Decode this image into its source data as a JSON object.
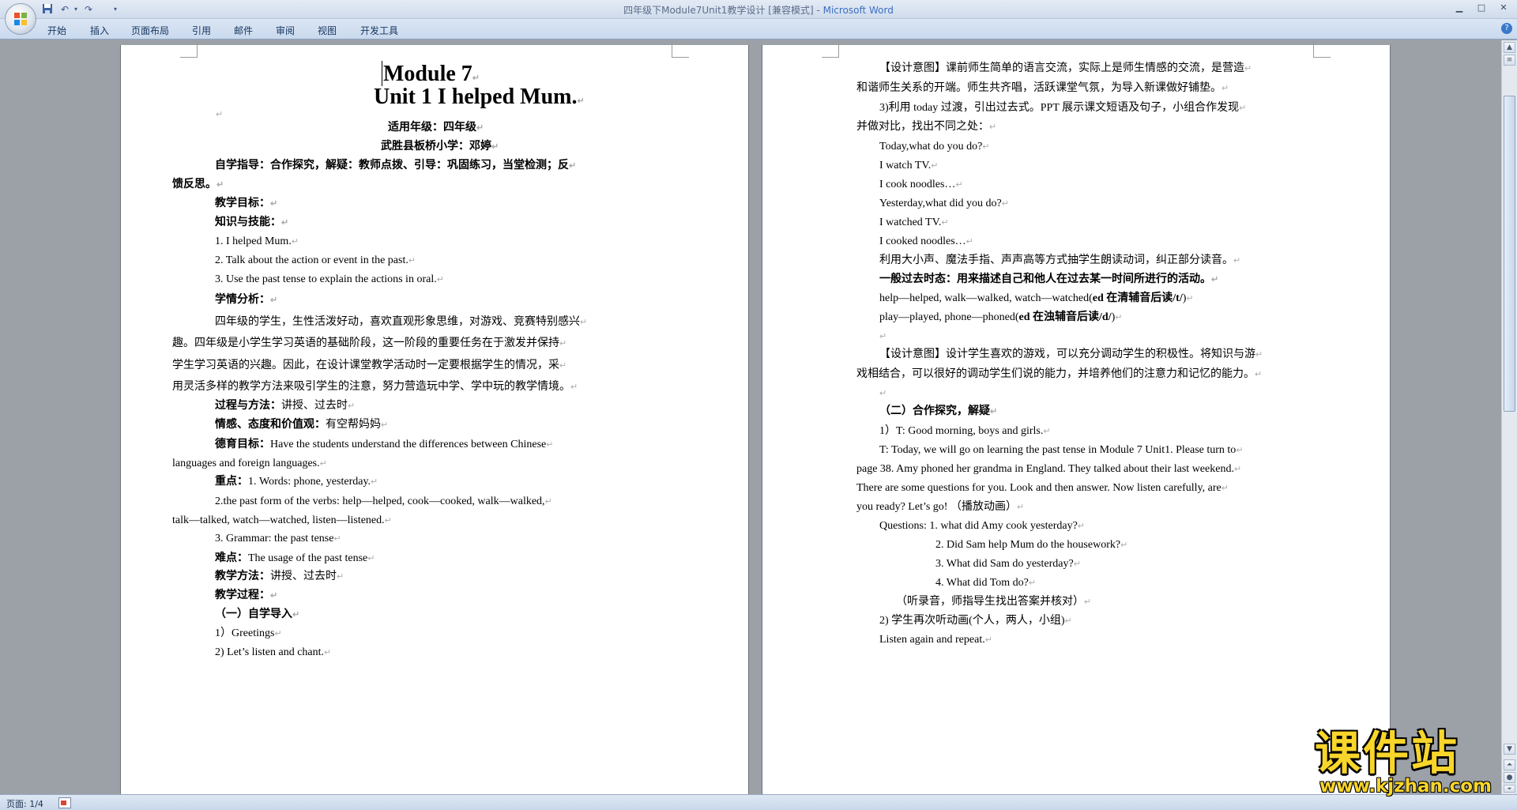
{
  "window": {
    "title": "四年级下Module7Unit1教学设计 [兼容模式] - ",
    "app": "Microsoft Word"
  },
  "ribbon": {
    "tabs": [
      "开始",
      "插入",
      "页面布局",
      "引用",
      "邮件",
      "审阅",
      "视图",
      "开发工具"
    ]
  },
  "status": {
    "page": "页面: 1/4"
  },
  "watermark": {
    "main": "课件站",
    "url": "www.kjzhan.com"
  },
  "icons": [
    "office-button-icon",
    "save-icon",
    "undo-icon",
    "redo-icon",
    "customize-qat-icon",
    "minimize-icon",
    "maximize-icon",
    "close-icon",
    "help-icon",
    "scroll-up-icon",
    "scroll-down-icon",
    "spelling-check-icon"
  ],
  "doc": {
    "left": [
      "Module 7",
      "Unit 1 I helped Mum.",
      "",
      "适用年级：四年级",
      "武胜县板桥小学：邓婷",
      "自学指导：合作探究，解疑：教师点拨、引导：巩固练习，当堂检测；反",
      "馈反思。",
      "教学目标：",
      "知识与技能：",
      "1. I helped Mum.",
      "2. Talk about the action or event in the past.",
      "3. Use the past tense to explain the actions in oral.",
      "学情分析：",
      "四年级的学生，生性活泼好动，喜欢直观形象思维，对游戏、竞赛特别感兴",
      "趣。四年级是小学生学习英语的基础阶段，这一阶段的重要任务在于激发并保持",
      "学生学习英语的兴趣。因此，在设计课堂教学活动时一定要根据学生的情况，采",
      "用灵活多样的教学方法来吸引学生的注意，努力营造玩中学、学中玩的教学情境。",
      [
        "过程与方法：",
        "讲授、过去时"
      ],
      [
        "情感、态度和价值观：",
        "有空帮妈妈"
      ],
      [
        "德育目标：",
        "Have  the  students  understand  the  differences  between  Chinese"
      ],
      "languages and foreign languages.",
      [
        "重点：",
        "1. Words: phone, yesterday."
      ],
      "2.the  past  form  of  the  verbs:  help—helped,  cook—cooked,  walk—walked,",
      "talk—talked, watch—watched, listen—listened.",
      "3. Grammar:  the past tense",
      [
        "难点：",
        "The usage of the past tense"
      ],
      [
        "教学方法：",
        "讲授、过去时"
      ],
      "教学过程：",
      "（一）自学导入",
      "1）Greetings",
      "2) Let’s listen and chant."
    ],
    "right": [
      "【设计意图】课前师生简单的语言交流，实际上是师生情感的交流，是营造",
      "和谐师生关系的开端。师生共齐唱，活跃课堂气氛，为导入新课做好铺垫。",
      "3)利用 today 过渡，引出过去式。PPT 展示课文短语及句子，小组合作发现",
      "并做对比，找出不同之处：",
      "Today,what do you do?",
      "I watch TV.",
      "I cook noodles…",
      "Yesterday,what did you do?",
      "I watched TV.",
      "I cooked noodles…",
      "利用大小声、魔法手指、声声高等方式抽学生朗读动词，纠正部分读音。",
      "一般过去时态：用来描述自己和他人在过去某一时间所进行的活动。",
      [
        "help—helped, walk—walked, watch—watched(",
        "ed 在清辅音后读/t/",
        ")"
      ],
      [
        "play—played, phone—phoned(",
        "ed 在浊辅音后读/d/",
        ")"
      ],
      "",
      "【设计意图】设计学生喜欢的游戏，可以充分调动学生的积极性。将知识与游",
      "戏相结合，可以很好的调动学生们说的能力，并培养他们的注意力和记忆的能力。",
      "",
      "（二）合作探究，解疑",
      "1）T: Good morning, boys and girls.",
      "T: Today, we will go on learning the past tense in Module 7 Unit1. Please turn to",
      "page 38. Amy phoned her grandma in England. They talked about their last weekend.",
      "There  are  some  questions  for  you.  Look  and  then  answer.  Now  listen  carefully,  are",
      "you ready? Let’s go!  （播放动画）",
      "Questions: 1. what did Amy cook yesterday?",
      "2. Did Sam help Mum  do the housework?",
      "3. What did Sam do yesterday?",
      "4. What did Tom  do?",
      "（听录音，师指导生找出答案并核对）",
      "2)  学生再次听动画(个人，两人，小组)",
      "Listen again and repeat."
    ]
  }
}
